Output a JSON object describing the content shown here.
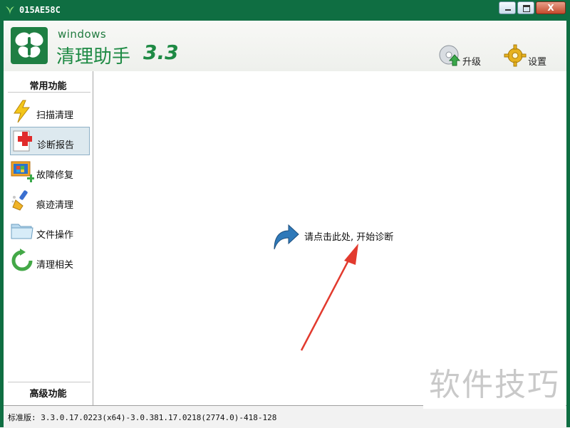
{
  "window": {
    "title": "015AE58C",
    "close_symbol": "X"
  },
  "header": {
    "brand_windows": "windows",
    "brand_name": "清理助手",
    "brand_version": "3.3",
    "upgrade_label": "升级",
    "settings_label": "设置"
  },
  "sidebar": {
    "common_heading": "常用功能",
    "advanced_heading": "高级功能",
    "items": [
      {
        "label": "扫描清理",
        "icon": "lightning-icon"
      },
      {
        "label": "诊断报告",
        "icon": "medical-report-icon"
      },
      {
        "label": "故障修复",
        "icon": "monitor-repair-icon"
      },
      {
        "label": "痕迹清理",
        "icon": "broom-icon"
      },
      {
        "label": "文件操作",
        "icon": "folder-icon"
      },
      {
        "label": "清理相关",
        "icon": "refresh-icon"
      }
    ],
    "selected_index": 1
  },
  "main": {
    "cta_label": "请点击此处, 开始诊断"
  },
  "status": {
    "text": "标准版: 3.3.0.17.0223(x64)-3.0.381.17.0218(2774.0)-418-128"
  },
  "watermark": "软件技巧",
  "colors": {
    "titlebar": "#0f6e42",
    "brand_green": "#1e8a44",
    "selected_bg": "#dde9ef",
    "annotation_arrow": "#e23a2e"
  }
}
